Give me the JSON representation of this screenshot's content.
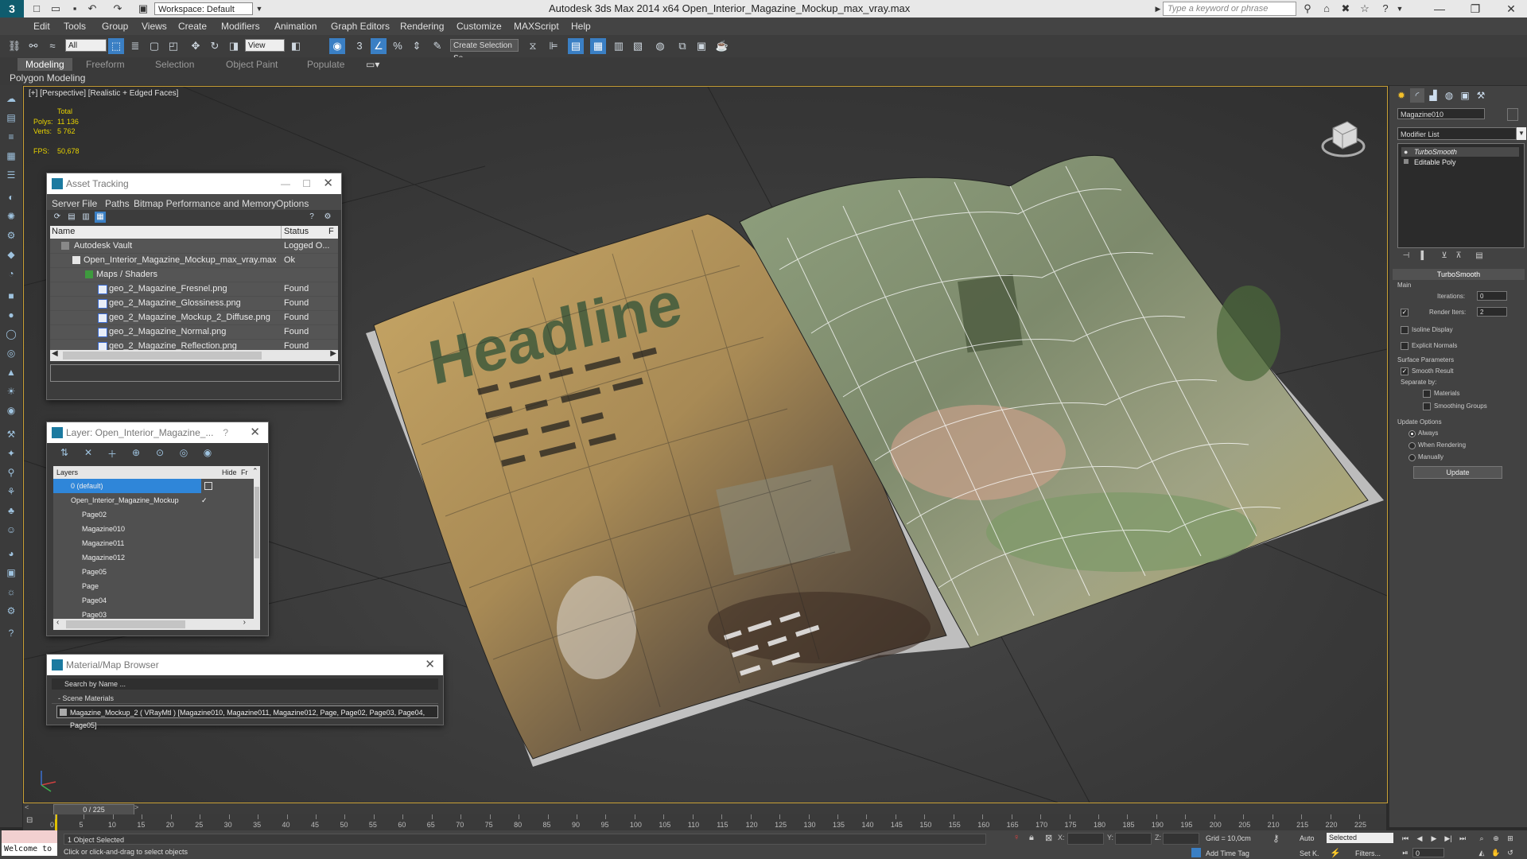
{
  "titlebar": {
    "workspace": "Workspace: Default",
    "app_title": "Autodesk 3ds Max  2014 x64     Open_Interior_Magazine_Mockup_max_vray.max",
    "search_placeholder": "Type a keyword or phrase"
  },
  "menu": [
    "Edit",
    "Tools",
    "Group",
    "Views",
    "Create",
    "Modifiers",
    "Animation",
    "Graph Editors",
    "Rendering",
    "Customize",
    "MAXScript",
    "Help"
  ],
  "toolbar": {
    "selection_filter": "All",
    "ref_coord": "View",
    "named_selection": "Create Selection Se"
  },
  "ribbon": {
    "tabs": [
      "Modeling",
      "Freeform",
      "Selection",
      "Object Paint",
      "Populate"
    ],
    "sub_label": "Polygon Modeling"
  },
  "viewport": {
    "label": "[+] [Perspective] [Realistic + Edged Faces]",
    "stats_total": "Total",
    "polys_label": "Polys:",
    "polys_value": "11 136",
    "verts_label": "Verts:",
    "verts_value": "5 762",
    "fps_label": "FPS:",
    "fps_value": "50,678",
    "headline_text": "Headline"
  },
  "asset_tracking": {
    "title": "Asset Tracking",
    "menu": [
      "Server",
      "File",
      "Paths",
      "Bitmap Performance and Memory",
      "Options"
    ],
    "col_name": "Name",
    "col_status": "Status",
    "col_extra": "F",
    "rows": [
      {
        "name": "Autodesk Vault",
        "status": "Logged O..."
      },
      {
        "name": "Open_Interior_Magazine_Mockup_max_vray.max",
        "status": "Ok"
      },
      {
        "name": "Maps / Shaders",
        "status": ""
      },
      {
        "name": "geo_2_Magazine_Fresnel.png",
        "status": "Found"
      },
      {
        "name": "geo_2_Magazine_Glossiness.png",
        "status": "Found"
      },
      {
        "name": "geo_2_Magazine_Mockup_2_Diffuse.png",
        "status": "Found"
      },
      {
        "name": "geo_2_Magazine_Normal.png",
        "status": "Found"
      },
      {
        "name": "geo_2_Magazine_Reflection.png",
        "status": "Found"
      }
    ]
  },
  "layer_explorer": {
    "title": "Layer: Open_Interior_Magazine_...",
    "help": "?",
    "col_layers": "Layers",
    "col_hide": "Hide",
    "col_fr": "Fr",
    "rows": [
      "0 (default)",
      "Open_Interior_Magazine_Mockup",
      "Page02",
      "Magazine010",
      "Magazine011",
      "Magazine012",
      "Page05",
      "Page",
      "Page04",
      "Page03"
    ]
  },
  "material_browser": {
    "title": "Material/Map Browser",
    "search_placeholder": "Search by Name ...",
    "section": "- Scene Materials",
    "material": "Magazine_Mockup_2  ( VRayMtl ) [Magazine010, Magazine011, Magazine012, Page, Page02, Page03, Page04, Page05]"
  },
  "command_panel": {
    "object_name": "Magazine010",
    "modifier_list": "Modifier List",
    "stack": [
      "TurboSmooth",
      "Editable Poly"
    ],
    "rollout_title": "TurboSmooth",
    "main_label": "Main",
    "iterations_label": "Iterations:",
    "iterations_value": "0",
    "render_iters_label": "Render Iters:",
    "render_iters_value": "2",
    "isoline_label": "Isoline Display",
    "explicit_normals_label": "Explicit Normals",
    "surface_params_label": "Surface Parameters",
    "smooth_result_label": "Smooth Result",
    "separate_by_label": "Separate by:",
    "materials_label": "Materials",
    "smoothing_groups_label": "Smoothing Groups",
    "update_options_label": "Update Options",
    "always_label": "Always",
    "when_rendering_label": "When Rendering",
    "manually_label": "Manually",
    "update_button": "Update"
  },
  "timeline": {
    "frame_counter": "0 / 225",
    "ticks": [
      "0",
      "5",
      "10",
      "15",
      "20",
      "25",
      "30",
      "35",
      "40",
      "45",
      "50",
      "55",
      "60",
      "65",
      "70",
      "75",
      "80",
      "85",
      "90",
      "95",
      "100",
      "105",
      "110",
      "115",
      "120",
      "125",
      "130",
      "135",
      "140",
      "145",
      "150",
      "155",
      "160",
      "165",
      "170",
      "175",
      "180",
      "185",
      "190",
      "195",
      "200",
      "205",
      "210",
      "215",
      "220",
      "225"
    ]
  },
  "statusbar": {
    "welcome": "Welcome to M",
    "selection_info": "1 Object Selected",
    "prompt": "Click or click-and-drag to select objects",
    "x_label": "X:",
    "y_label": "Y:",
    "z_label": "Z:",
    "grid": "Grid = 10,0cm",
    "add_time_tag": "Add Time Tag",
    "auto": "Auto",
    "set_key": "Set K.",
    "selected": "Selected",
    "filters": "Filters...",
    "frame": "0"
  }
}
